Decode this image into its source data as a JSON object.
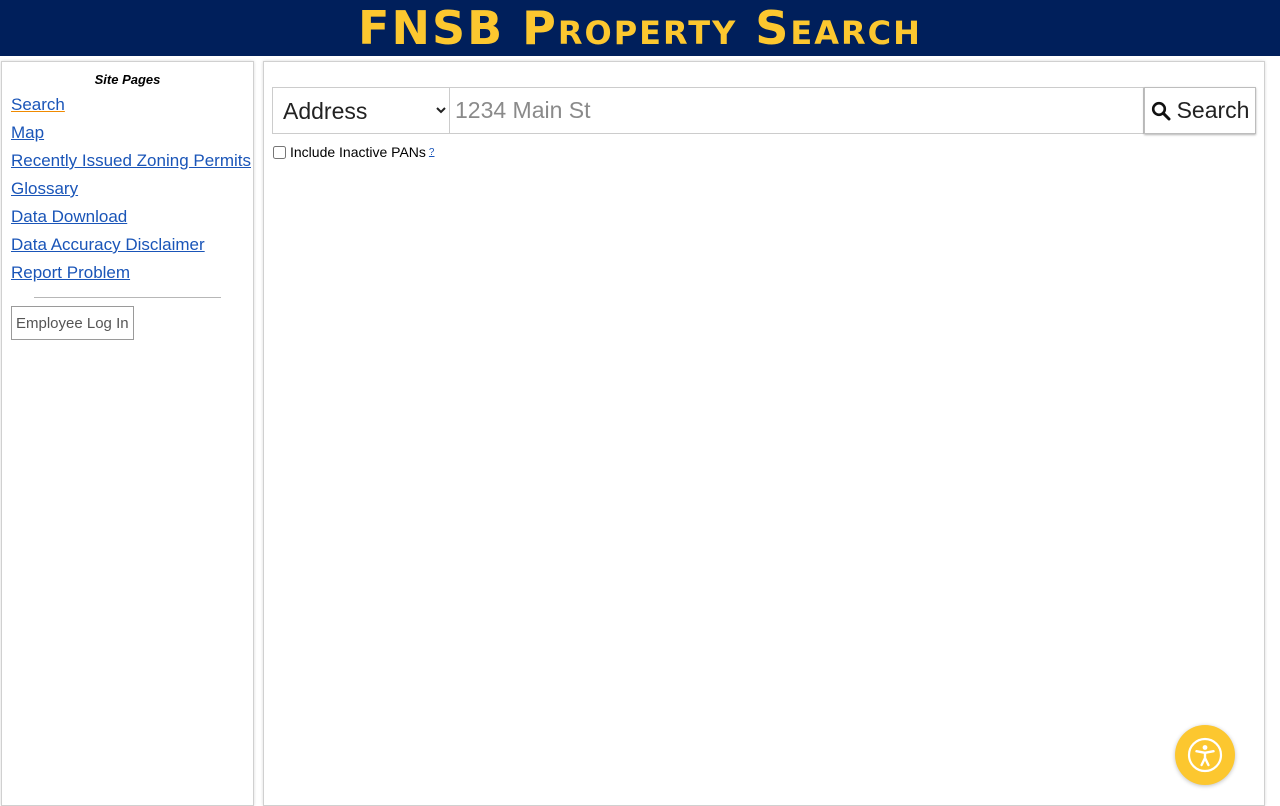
{
  "header": {
    "title": "FNSB Property Search"
  },
  "sidebar": {
    "heading": "Site Pages",
    "items": [
      {
        "label": "Search"
      },
      {
        "label": "Map"
      },
      {
        "label": "Recently Issued Zoning Permits"
      },
      {
        "label": "Glossary"
      },
      {
        "label": "Data Download"
      },
      {
        "label": "Data Accuracy Disclaimer"
      },
      {
        "label": "Report Problem"
      }
    ],
    "login_label": "Employee Log In"
  },
  "search": {
    "type_selected": "Address",
    "placeholder": "1234 Main St",
    "value": "",
    "button_label": "Search",
    "inactive_label": "Include Inactive PANs",
    "help_marker": "?"
  },
  "colors": {
    "header_bg": "#001f5b",
    "header_text": "#fcc72f",
    "link": "#1a55b8",
    "accessibility_button": "#fcc72f"
  },
  "icons": {
    "search": "magnifier-icon",
    "accessibility": "accessibility-person-icon"
  }
}
